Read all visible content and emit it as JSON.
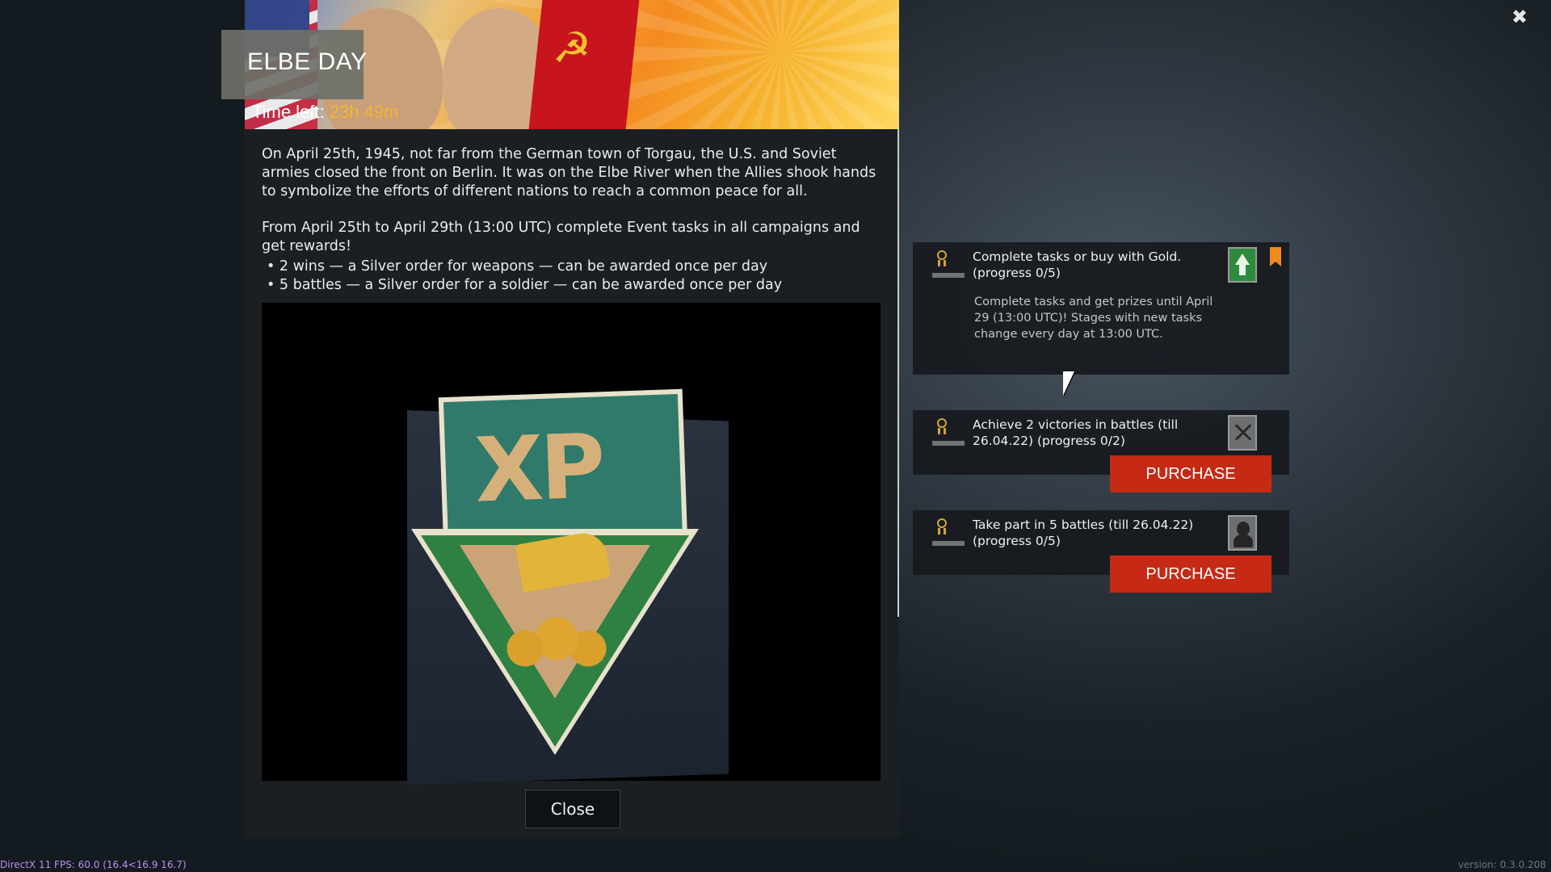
{
  "window": {
    "close_glyph": "✖"
  },
  "event": {
    "title": "ELBE DAY",
    "time_left_label": "Time left:",
    "time_left_value": "23h 49m",
    "description_1": "On April 25th, 1945, not far from the German town of Torgau, the U.S. and Soviet armies closed the front on Berlin. It was on the Elbe River when the Allies shook hands to symbolize the efforts of different nations to reach a common peace for all.",
    "description_2": "From April 25th to April 29th (13:00 UTC) complete Event tasks in all campaigns and get rewards!",
    "bullets": [
      "• 2 wins — a Silver order for weapons — can be awarded once per day",
      "• 5 battles — a Silver order for a soldier — can be awarded once per day"
    ],
    "preview_image_text": "XP",
    "close_label": "Close"
  },
  "tasks": [
    {
      "title": "Complete tasks or buy with Gold. (progress 0/5)",
      "body": "Complete tasks and get prizes until April 29 (13:00 UTC)! Stages with new tasks change every day at 13:00 UTC.",
      "progress": 0.0,
      "reward_icon": "upgrade-arrow-icon",
      "bookmarked": true
    },
    {
      "title": "Achieve 2 victories in battles (till 26.04.22) (progress 0/2)",
      "purchase_label": "PURCHASE",
      "progress": 0.0,
      "reward_icon": "weapon-order-icon"
    },
    {
      "title": "Take part in 5 battles (till 26.04.22) (progress 0/5)",
      "purchase_label": "PURCHASE",
      "progress": 0.0,
      "reward_icon": "soldier-order-icon"
    }
  ],
  "footer": {
    "fps": "DirectX 11 FPS: 60.0 (16.4<16.9 16.7)",
    "version": "version: 0.3.0.208"
  },
  "colors": {
    "accent_orange": "#f2b533",
    "purchase_red": "#c62a14",
    "panel_bg": "#1b1f22"
  }
}
